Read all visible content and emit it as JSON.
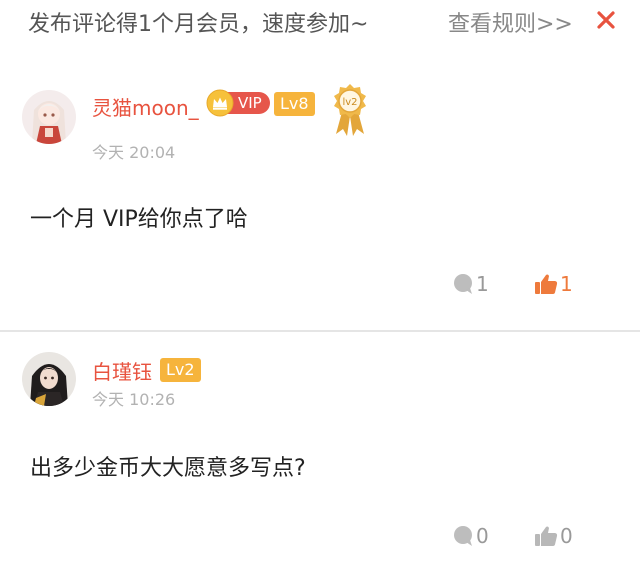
{
  "promo": {
    "text": "发布评论得1个月会员，速度参加~",
    "rules_link": "查看规则>>",
    "close_icon": "close-icon",
    "accent": "#e8533f"
  },
  "comments": [
    {
      "username": "灵猫moon_",
      "vip_label": "VIP",
      "level": "Lv8",
      "medal_label": "lv2",
      "time": "今天 20:04",
      "text": "一个月 VIP给你点了哈",
      "reply_count": "1",
      "like_count": "1",
      "liked": true
    },
    {
      "username": "白瑾钰",
      "level": "Lv2",
      "time": "今天 10:26",
      "text": "出多少金币大大愿意多写点?",
      "reply_count": "0",
      "like_count": "0",
      "liked": false
    }
  ],
  "colors": {
    "username": "#e8533f",
    "level_badge": "#f6b43c",
    "vip_badge": "#e6564b",
    "like_active": "#ee7a3c",
    "muted": "#999999"
  }
}
